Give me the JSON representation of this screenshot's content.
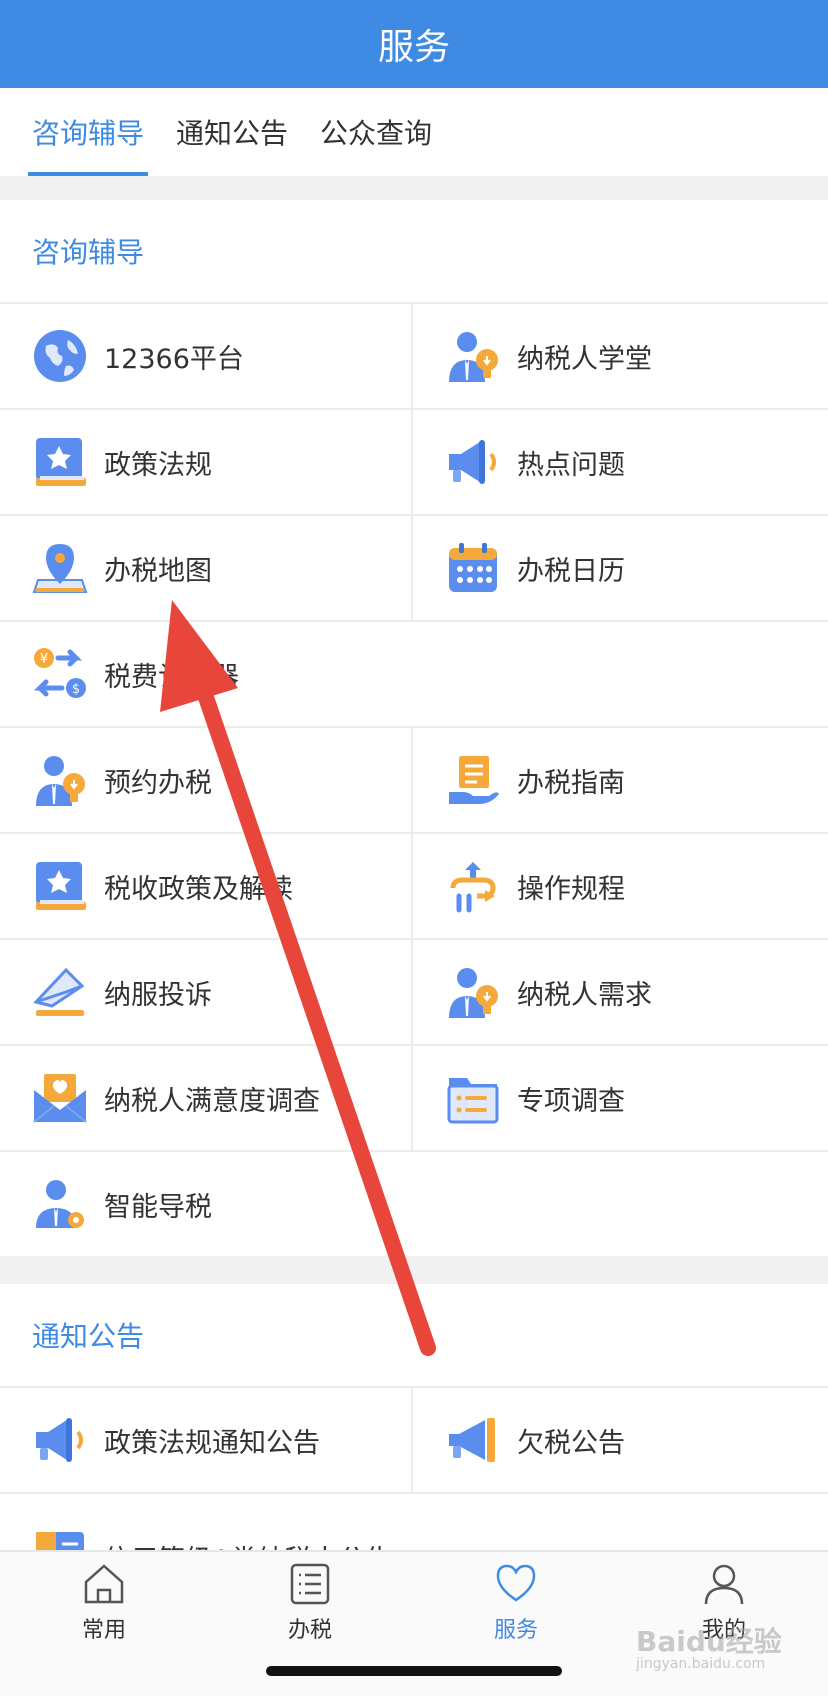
{
  "header": {
    "title": "服务"
  },
  "tabs": [
    {
      "label": "咨询辅导"
    },
    {
      "label": "通知公告"
    },
    {
      "label": "公众查询"
    }
  ],
  "sections": {
    "consult": {
      "title": "咨询辅导",
      "items": [
        {
          "label": "12366平台",
          "icon": "globe-icon"
        },
        {
          "label": "纳税人学堂",
          "icon": "person-bulb-icon"
        },
        {
          "label": "政策法规",
          "icon": "star-book-icon"
        },
        {
          "label": "热点问题",
          "icon": "megaphone-icon"
        },
        {
          "label": "办税地图",
          "icon": "map-pin-icon"
        },
        {
          "label": "办税日历",
          "icon": "calendar-icon"
        },
        {
          "label": "税费计算器",
          "icon": "exchange-icon"
        },
        {
          "label": "预约办税",
          "icon": "person-bulb-icon"
        },
        {
          "label": "办税指南",
          "icon": "hand-doc-icon"
        },
        {
          "label": "税收政策及解读",
          "icon": "star-book-icon"
        },
        {
          "label": "操作规程",
          "icon": "flow-icon"
        },
        {
          "label": "纳服投诉",
          "icon": "paper-plane-icon"
        },
        {
          "label": "纳税人需求",
          "icon": "person-bulb-icon"
        },
        {
          "label": "纳税人满意度调查",
          "icon": "heart-mail-icon"
        },
        {
          "label": "专项调查",
          "icon": "folder-list-icon"
        },
        {
          "label": "智能导税",
          "icon": "person-gear-icon"
        }
      ]
    },
    "notice": {
      "title": "通知公告",
      "items": [
        {
          "label": "政策法规通知公告",
          "icon": "megaphone-icon"
        },
        {
          "label": "欠税公告",
          "icon": "megaphone-icon"
        },
        {
          "label": "信用等级A类纳税人公告",
          "icon": "credit-doc-icon"
        }
      ]
    }
  },
  "bottom_nav": [
    {
      "label": "常用",
      "icon": "home-icon"
    },
    {
      "label": "办税",
      "icon": "list-icon"
    },
    {
      "label": "服务",
      "icon": "heart-icon"
    },
    {
      "label": "我的",
      "icon": "user-icon"
    }
  ],
  "watermark": {
    "text": "Baidu经验",
    "sub": "jingyan.baidu.com"
  },
  "colors": {
    "accent": "#3f8ae3",
    "arrow": "#e8463b",
    "icon_blue": "#5b8def",
    "icon_orange": "#f5a93b"
  }
}
